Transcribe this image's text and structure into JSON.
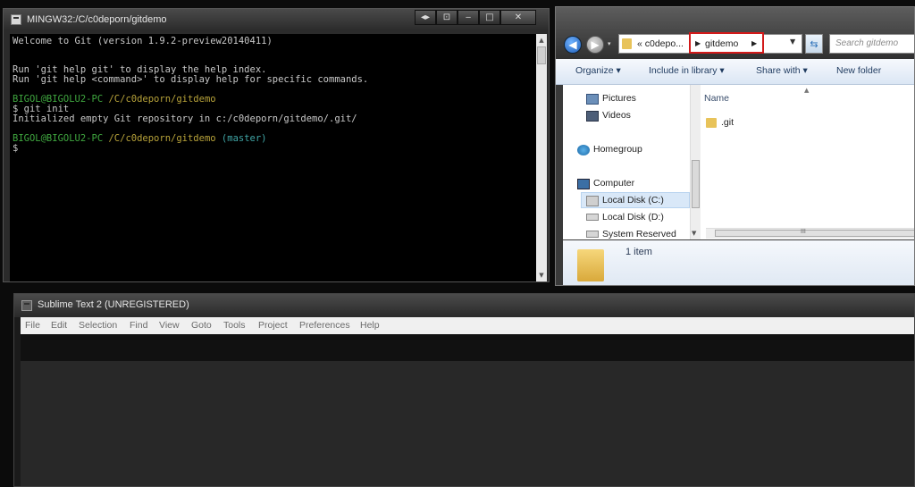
{
  "terminal": {
    "title": "MINGW32:/C/c0deporn/gitdemo",
    "lines": {
      "l1": "Welcome to Git (version 1.9.2-preview20140411)",
      "l2": "Run 'git help git' to display the help index.",
      "l3": "Run 'git help <command>' to display help for specific commands.",
      "p1_user": "BIGOL@BIGOLU2-PC",
      "p1_path": "/C/c0deporn/gitdemo",
      "cmd1": "$ git init",
      "out1": "Initialized empty Git repository in c:/c0deporn/gitdemo/.git/",
      "p2_user": "BIGOL@BIGOLU2-PC",
      "p2_path": "/C/c0deporn/gitdemo",
      "p2_branch": "(master)",
      "cmd2": "$"
    }
  },
  "explorer": {
    "breadcrumb_parent": "« c0depo...",
    "breadcrumb_current": "gitdemo",
    "search_placeholder": "Search gitdemo",
    "commands": {
      "organize": "Organize ▾",
      "include": "Include in library ▾",
      "share": "Share with ▾",
      "newfolder": "New folder"
    },
    "nav_items": {
      "pictures": "Pictures",
      "videos": "Videos",
      "homegroup": "Homegroup",
      "computer": "Computer",
      "localc": "Local Disk (C:)",
      "locald": "Local Disk (D:)",
      "sysres": "System Reserved"
    },
    "column_name": "Name",
    "files": {
      "f1": ".git"
    },
    "item_count": "1 item",
    "scroll_grip": "III"
  },
  "sublime": {
    "title": "Sublime Text 2 (UNREGISTERED)",
    "menu": {
      "file": "File",
      "edit": "Edit",
      "selection": "Selection",
      "find": "Find",
      "view": "View",
      "goto": "Goto",
      "tools": "Tools",
      "project": "Project",
      "preferences": "Preferences",
      "help": "Help"
    }
  },
  "icons": {
    "terminal_app": "console-icon",
    "folder": "folder-icon",
    "back": "back-arrow-icon",
    "forward": "forward-arrow-icon",
    "refresh": "refresh-icon"
  },
  "colors": {
    "prompt_green": "#3fa63f",
    "branch_cyan": "#40a6a6",
    "highlight_red": "#d21a1a"
  }
}
